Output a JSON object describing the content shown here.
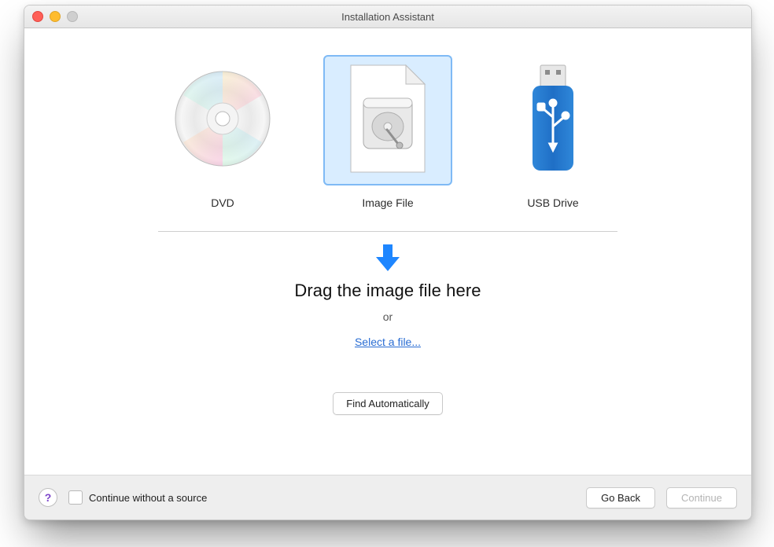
{
  "window": {
    "title": "Installation Assistant"
  },
  "sources": [
    {
      "id": "dvd",
      "label": "DVD",
      "selected": false
    },
    {
      "id": "image-file",
      "label": "Image File",
      "selected": true
    },
    {
      "id": "usb-drive",
      "label": "USB Drive",
      "selected": false
    }
  ],
  "drop": {
    "instruction": "Drag the image file here",
    "or": "or",
    "select_link": "Select a file..."
  },
  "buttons": {
    "find_auto": "Find Automatically",
    "go_back": "Go Back",
    "continue": "Continue"
  },
  "footer": {
    "checkbox_label": "Continue without a source",
    "checkbox_checked": false,
    "continue_enabled": false
  },
  "colors": {
    "accent": "#1e86ff",
    "link": "#2a6dd3",
    "selected_bg": "#d9edff",
    "selected_border": "#7fbaf5"
  }
}
